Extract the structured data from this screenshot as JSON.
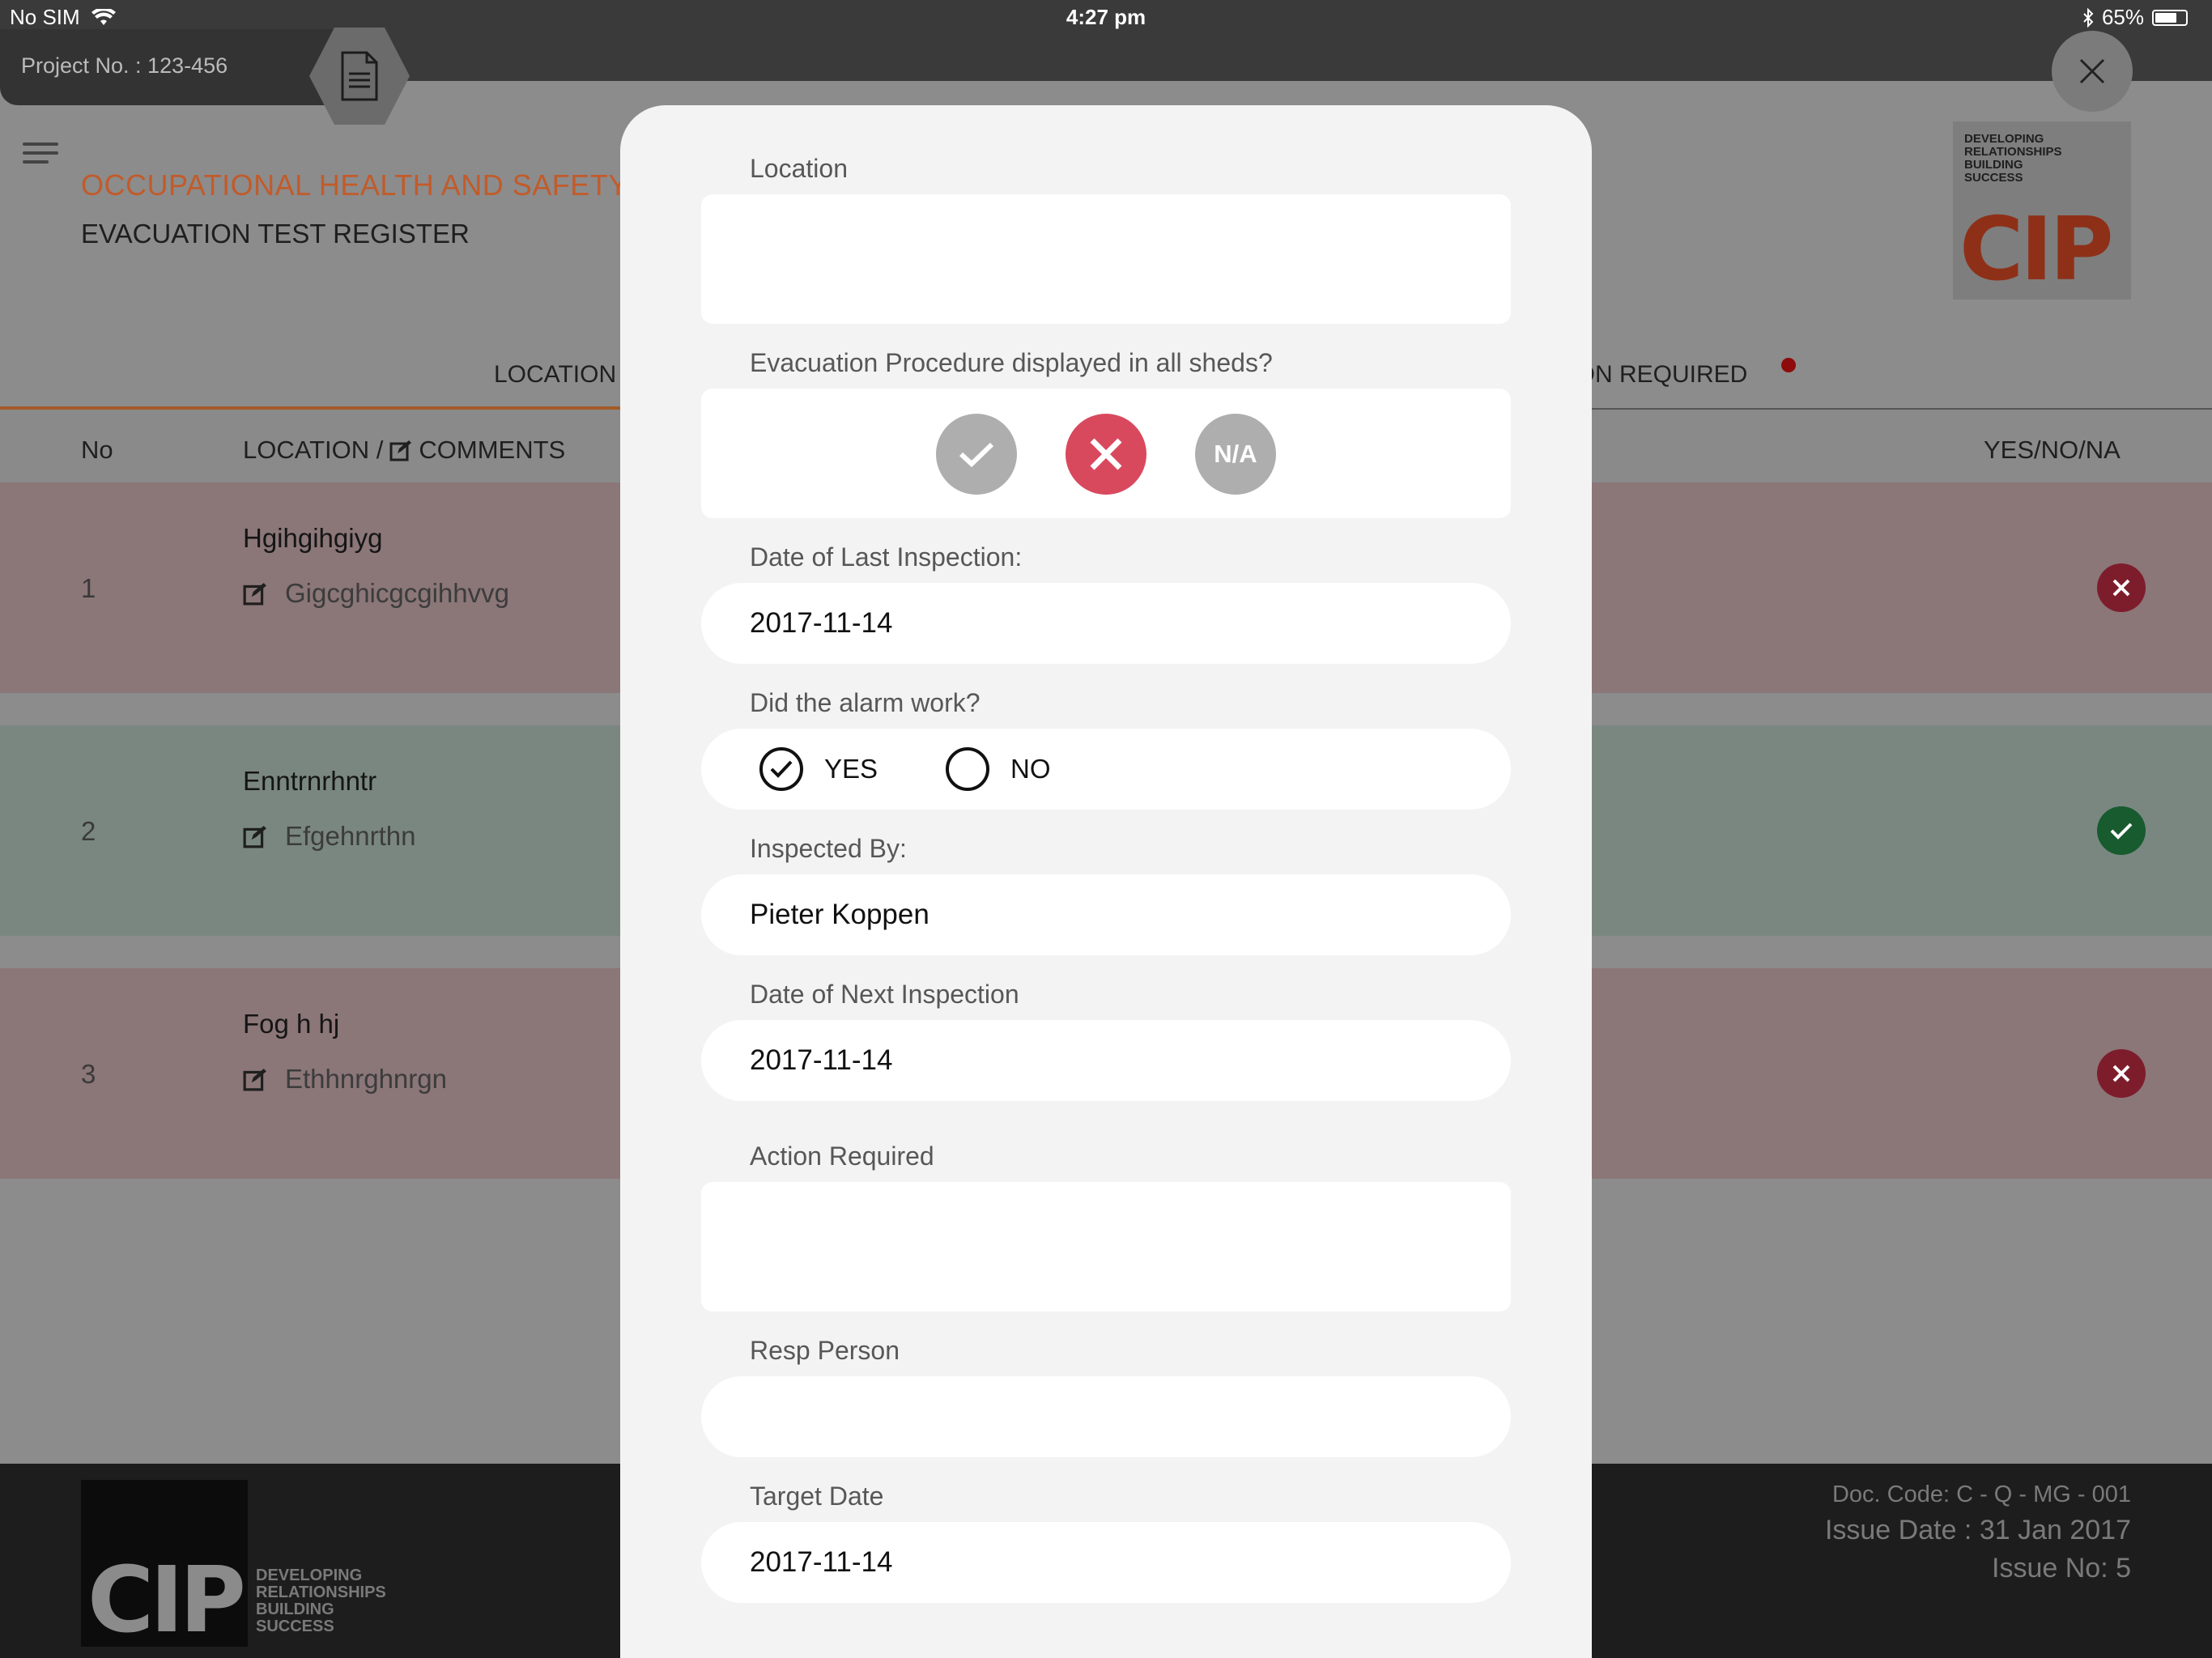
{
  "status_bar": {
    "carrier": "No SIM",
    "time": "4:27 pm",
    "battery": "65%"
  },
  "project": {
    "label": "Project No. : 123-456"
  },
  "header": {
    "title": "OCCUPATIONAL HEALTH AND SAFETY",
    "subtitle": "EVACUATION TEST REGISTER"
  },
  "logo": {
    "tagline": [
      "DEVELOPING",
      "RELATIONSHIPS",
      "BUILDING",
      "SUCCESS"
    ],
    "brand": "CIP"
  },
  "tabs": {
    "location": "LOCATION",
    "action_required": "TION REQUIRED"
  },
  "table": {
    "col_no": "No",
    "col_location": "LOCATION /",
    "col_comments": "COMMENTS",
    "col_status": "YES/NO/NA",
    "rows": [
      {
        "no": "1",
        "location": "Hgihgihgiyg",
        "comment": "Gigcghicgcgihhvvg",
        "status": "no"
      },
      {
        "no": "2",
        "location": "Enntrnrhntr",
        "comment": "Efgehnrthn",
        "status": "yes"
      },
      {
        "no": "3",
        "location": "Fog h hj",
        "comment": "Ethhnrghnrgn",
        "status": "no"
      }
    ]
  },
  "footer": {
    "doc_code": "Doc. Code: C - Q - MG - 001",
    "issue_date": "Issue Date : 31 Jan 2017",
    "issue_no": "Issue No: 5"
  },
  "form": {
    "location_label": "Location",
    "location_value": "",
    "procedure_label": "Evacuation Procedure displayed in all sheds?",
    "procedure_selected": "no",
    "na_label": "N/A",
    "last_inspection_label": "Date of Last Inspection:",
    "last_inspection_value": "2017-11-14",
    "alarm_label": "Did the alarm work?",
    "alarm_yes": "YES",
    "alarm_no": "NO",
    "alarm_selected": "yes",
    "inspected_by_label": "Inspected By:",
    "inspected_by_value": "Pieter Koppen",
    "next_inspection_label": "Date of Next Inspection",
    "next_inspection_value": "2017-11-14",
    "action_required_label": "Action Required",
    "action_required_value": "",
    "resp_person_label": "Resp Person",
    "resp_person_value": "",
    "target_date_label": "Target Date",
    "target_date_value": "2017-11-14"
  },
  "colors": {
    "accent": "#c25b2a",
    "no": "#d9495e",
    "yes": "#1f7a3c",
    "neutral": "#aeaeae"
  }
}
